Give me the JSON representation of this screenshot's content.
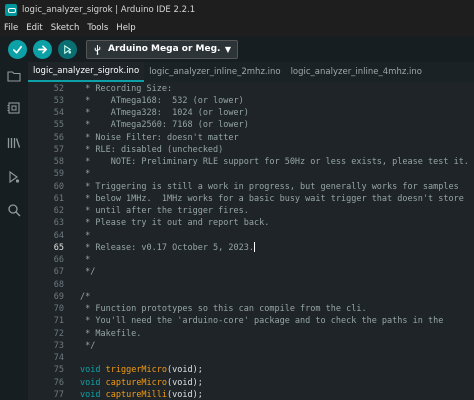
{
  "window": {
    "title": "logic_analyzer_sigrok | Arduino IDE 2.2.1"
  },
  "menu": [
    "File",
    "Edit",
    "Sketch",
    "Tools",
    "Help"
  ],
  "toolbar": {
    "board": "Arduino Mega or Meg..."
  },
  "tabs": [
    {
      "label": "logic_analyzer_sigrok.ino",
      "active": true
    },
    {
      "label": "logic_analyzer_inline_2mhz.ino",
      "active": false
    },
    {
      "label": "logic_analyzer_inline_4mhz.ino",
      "active": false
    }
  ],
  "editor": {
    "current_line": "65",
    "lines": [
      {
        "n": "52",
        "text": " * Recording Size:"
      },
      {
        "n": "53",
        "text": " *    ATmega168:  532 (or lower)"
      },
      {
        "n": "54",
        "text": " *    ATmega328:  1024 (or lower)"
      },
      {
        "n": "55",
        "text": " *    ATmega2560: 7168 (or lower)"
      },
      {
        "n": "56",
        "text": " * Noise Filter: doesn't matter"
      },
      {
        "n": "57",
        "text": " * RLE: disabled (unchecked)"
      },
      {
        "n": "58",
        "text": " *    NOTE: Preliminary RLE support for 50Hz or less exists, please test it."
      },
      {
        "n": "59",
        "text": " *"
      },
      {
        "n": "60",
        "text": " * Triggering is still a work in progress, but generally works for samples"
      },
      {
        "n": "61",
        "text": " * below 1MHz.  1MHz works for a basic busy wait trigger that doesn't store"
      },
      {
        "n": "62",
        "text": " * until after the trigger fires."
      },
      {
        "n": "63",
        "text": " * Please try it out and report back."
      },
      {
        "n": "64",
        "text": " *"
      },
      {
        "n": "65",
        "text": " * Release: v0.17 October 5, 2023."
      },
      {
        "n": "66",
        "text": " *"
      },
      {
        "n": "67",
        "text": " */"
      },
      {
        "n": "68",
        "text": ""
      },
      {
        "n": "69",
        "text": "/*"
      },
      {
        "n": "70",
        "text": " * Function prototypes so this can compile from the cli."
      },
      {
        "n": "71",
        "text": " * You'll need the 'arduino-core' package and to check the paths in the"
      },
      {
        "n": "72",
        "text": " * Makefile."
      },
      {
        "n": "73",
        "text": " */"
      },
      {
        "n": "74",
        "text": ""
      },
      {
        "n": "75",
        "kw": "void",
        "fn": "triggerMicro",
        "rest": "(void);"
      },
      {
        "n": "76",
        "kw": "void",
        "fn": "captureMicro",
        "rest": "(void);"
      },
      {
        "n": "77",
        "kw": "void",
        "fn": "captureMilli",
        "rest": "(void);"
      }
    ]
  },
  "colors": {
    "accent": "#0ca1a6",
    "comment": "#95a5a6",
    "function": "#f39c12",
    "background": "#1f2428"
  },
  "icons": {
    "verify": "check-icon",
    "upload": "arrow-right-icon",
    "debug": "debug-icon",
    "board": "usb-icon",
    "sidebar": [
      "folder-icon",
      "board-manager-icon",
      "library-icon",
      "debug-icon",
      "search-icon"
    ]
  }
}
